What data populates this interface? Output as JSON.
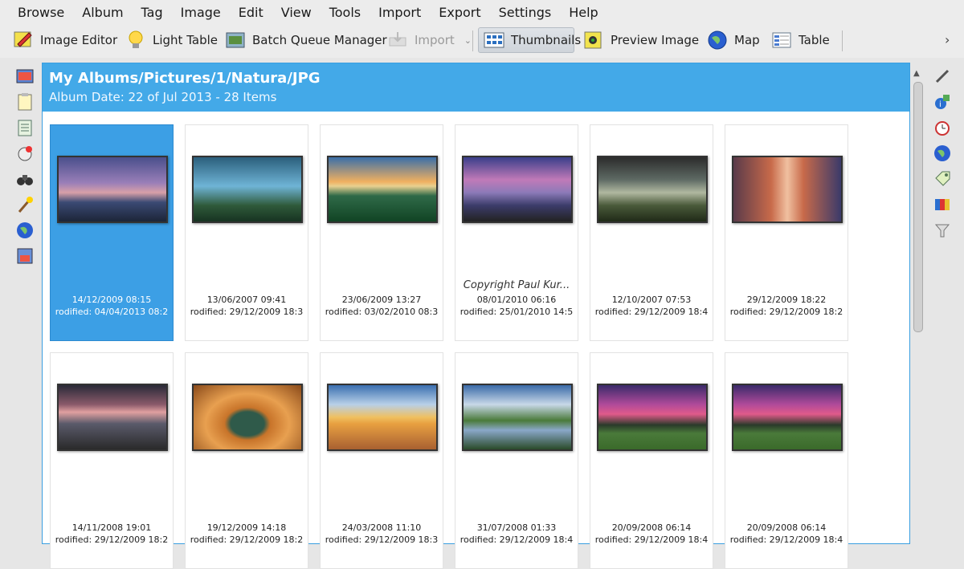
{
  "menu": [
    "Browse",
    "Album",
    "Tag",
    "Image",
    "Edit",
    "View",
    "Tools",
    "Import",
    "Export",
    "Settings",
    "Help"
  ],
  "toolbar": {
    "image_editor": "Image Editor",
    "light_table": "Light Table",
    "batch_queue": "Batch Queue Manager",
    "import": "Import",
    "thumbnails": "Thumbnails",
    "preview": "Preview Image",
    "map": "Map",
    "table": "Table"
  },
  "album": {
    "title": "My Albums/Pictures/1/Natura/JPG",
    "subtitle": "Album Date: 22 of Jul 2013 - 28 Items"
  },
  "items": [
    {
      "date": "14/12/2009 08:15",
      "modified": "rodified: 04/04/2013 08:2",
      "copyright": ""
    },
    {
      "date": "13/06/2007 09:41",
      "modified": "rodified: 29/12/2009 18:3",
      "copyright": ""
    },
    {
      "date": "23/06/2009 13:27",
      "modified": "rodified: 03/02/2010 08:3",
      "copyright": ""
    },
    {
      "date": "08/01/2010 06:16",
      "modified": "rodified: 25/01/2010 14:5",
      "copyright": "Copyright Paul Kur..."
    },
    {
      "date": "12/10/2007 07:53",
      "modified": "rodified: 29/12/2009 18:4",
      "copyright": ""
    },
    {
      "date": "29/12/2009 18:22",
      "modified": "rodified: 29/12/2009 18:2",
      "copyright": ""
    },
    {
      "date": "14/11/2008 19:01",
      "modified": "rodified: 29/12/2009 18:2",
      "copyright": ""
    },
    {
      "date": "19/12/2009 14:18",
      "modified": "rodified: 29/12/2009 18:2",
      "copyright": ""
    },
    {
      "date": "24/03/2008 11:10",
      "modified": "rodified: 29/12/2009 18:3",
      "copyright": ""
    },
    {
      "date": "31/07/2008 01:33",
      "modified": "rodified: 29/12/2009 18:4",
      "copyright": ""
    },
    {
      "date": "20/09/2008 06:14",
      "modified": "rodified: 29/12/2009 18:4",
      "copyright": ""
    },
    {
      "date": "20/09/2008 06:14",
      "modified": "rodified: 29/12/2009 18:4",
      "copyright": ""
    }
  ]
}
